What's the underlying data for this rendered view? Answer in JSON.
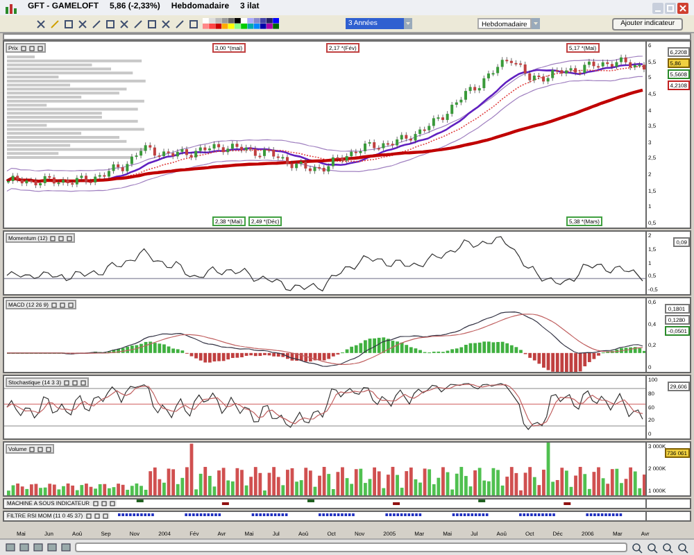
{
  "window": {
    "ticker": "GFT - GAMELOFT",
    "change": "5,86 (-2,33%)",
    "period": "Hebdomadaire",
    "date_label": "3 ilat"
  },
  "toolbar": {
    "range_select": "3 Années",
    "period_select": "Hebdomadaire",
    "add_button": "Ajouter indicateur"
  },
  "panes": [
    {
      "kind": "price",
      "label": "Prix",
      "axis": [
        "6",
        "5,5",
        "5",
        "4,5",
        "4",
        "3,5",
        "3",
        "2,5",
        "2",
        "1,5",
        "1",
        "0,5"
      ],
      "value_boxes": [
        {
          "text": "6,2208",
          "kind": "level"
        },
        {
          "text": "5,86",
          "kind": "current"
        },
        {
          "text": "5,5608",
          "kind": "signal"
        },
        {
          "text": "4,2108",
          "kind": "trend"
        }
      ],
      "annotations": [
        {
          "text": "3,00 *(mai)",
          "kind": "high"
        },
        {
          "text": "2,17 *(Fév)",
          "kind": "high"
        },
        {
          "text": "5,17 *(Mai)",
          "kind": "high"
        },
        {
          "text": "2,38 *(Mai)",
          "kind": "low"
        },
        {
          "text": "2,49 *(Déc)",
          "kind": "low"
        },
        {
          "text": "5,38 *(Mars)",
          "kind": "low"
        }
      ]
    },
    {
      "kind": "momentum",
      "label": "Momentum (12)",
      "axis": [
        "2",
        "1,5",
        "1",
        "0,5",
        "-0,5"
      ],
      "value_boxes": [
        {
          "text": "0,09",
          "kind": "level"
        }
      ]
    },
    {
      "kind": "macd",
      "label": "MACD (12 26 9)",
      "axis": [
        "0,6",
        "0,4",
        "0,2",
        "0"
      ],
      "value_boxes": [
        {
          "text": "0,1801",
          "kind": "level"
        },
        {
          "text": "0,1280",
          "kind": "level"
        },
        {
          "text": "-0,0501",
          "kind": "signal"
        }
      ]
    },
    {
      "kind": "stoch",
      "label": "Stochastique (14 3 3)",
      "axis": [
        "100",
        "80",
        "60",
        "20",
        "0"
      ],
      "value_boxes": [
        {
          "text": "29,606",
          "kind": "level"
        }
      ]
    },
    {
      "kind": "volume",
      "label": "Volume",
      "axis": [
        "3 000K",
        "2 000K",
        "1 000K"
      ],
      "value_boxes": [
        {
          "text": "736 061",
          "kind": "current"
        }
      ]
    },
    {
      "kind": "signals",
      "label": "MACHINE A SOUS INDICATEUR"
    },
    {
      "kind": "filter",
      "label": "FILTRE RSI MOM (11 0 45 37)"
    }
  ],
  "x_axis": [
    "Mai",
    "Jun",
    "Aoû",
    "Sep",
    "Nov",
    "2004",
    "Fév",
    "Avr",
    "Mai",
    "Jul",
    "Aoû",
    "Oct",
    "Nov",
    "2005",
    "Mar",
    "Mai",
    "Jul",
    "Aoû",
    "Oct",
    "Déc",
    "2006",
    "Mar",
    "Avr"
  ]
}
